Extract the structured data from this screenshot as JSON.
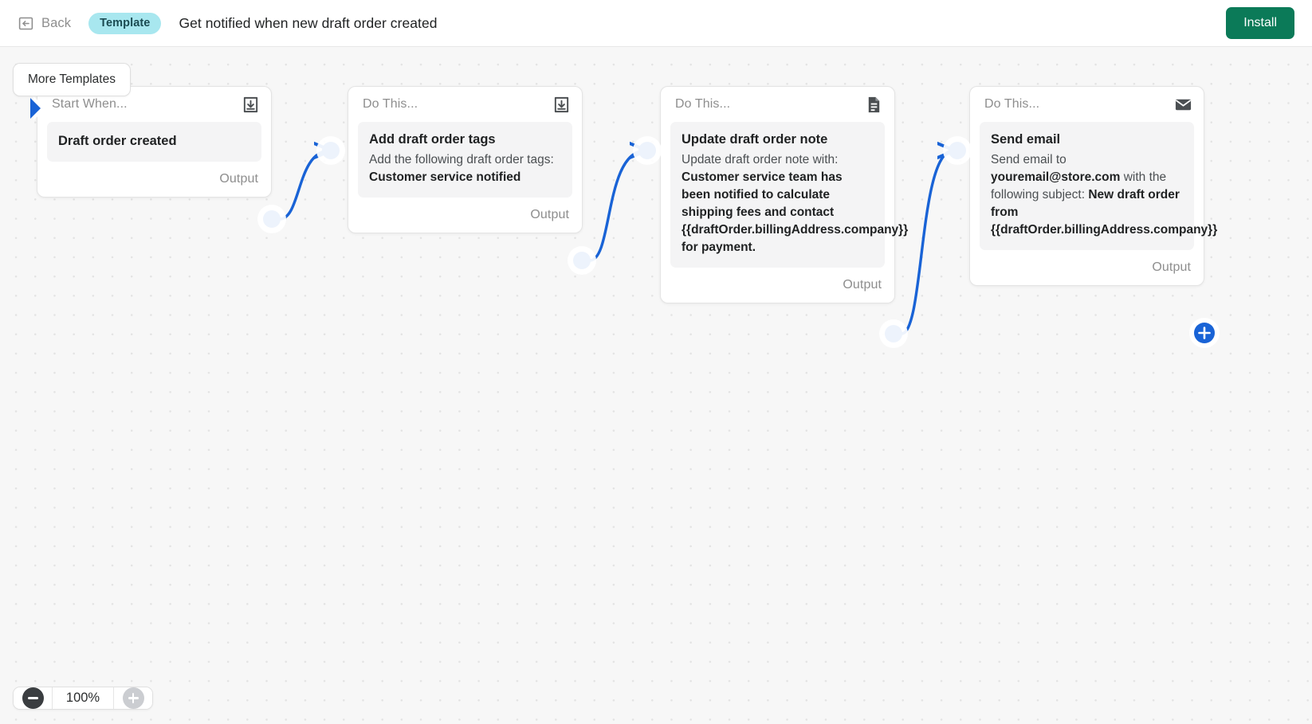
{
  "topbar": {
    "back_label": "Back",
    "back_icon": "back-arrow-icon",
    "badge_label": "Template",
    "title": "Get notified when new draft order created",
    "install_label": "Install",
    "install_color": "#0b7a58",
    "badge_color": "#a8e7ef"
  },
  "canvas": {
    "more_templates_label": "More Templates",
    "accent_color": "#1963d6",
    "background_color": "#f7f7f7"
  },
  "nodes": [
    {
      "header": "Start When...",
      "header_icon": "import-download-icon",
      "body_title": "Draft order created",
      "body_text_html": "",
      "output_label": "Output",
      "has_play_marker": true
    },
    {
      "header": "Do This...",
      "header_icon": "import-download-icon",
      "body_title": "Add draft order tags",
      "body_text_html": "Add the following draft order tags: <b>Customer service notified</b>",
      "output_label": "Output",
      "has_play_marker": false
    },
    {
      "header": "Do This...",
      "header_icon": "document-note-icon",
      "body_title": "Update draft order note",
      "body_text_html": "Update draft order note with: <b>Customer service team has been notified to calculate shipping fees and contact {{draftOrder.billingAddress.company}} for payment.</b>",
      "output_label": "Output",
      "has_play_marker": false
    },
    {
      "header": "Do This...",
      "header_icon": "envelope-email-icon",
      "body_title": "Send email",
      "body_text_html": "Send email to <b>youremail@store.com</b> with the following subject: <b>New draft order from {{draftOrder.billingAddress.company}}</b>",
      "output_label": "Output",
      "has_play_marker": false,
      "has_add_port": true
    }
  ],
  "zoom_control": {
    "zoom_out_icon": "minus-circle-icon",
    "zoom_in_icon": "plus-circle-icon",
    "level": "100%"
  }
}
